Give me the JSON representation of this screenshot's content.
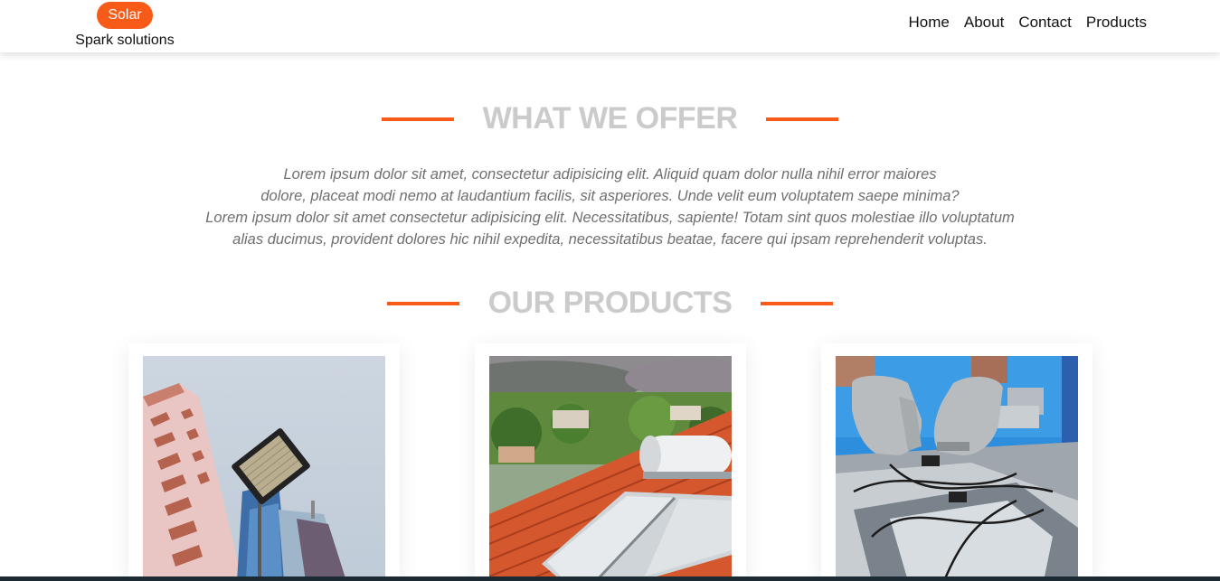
{
  "brand": {
    "badge": "Solar",
    "subtitle": "Spark solutions"
  },
  "nav": {
    "items": [
      "Home",
      "About",
      "Contact",
      "Products"
    ]
  },
  "offer": {
    "title": "WHAT WE OFFER",
    "lines": [
      "Lorem ipsum dolor sit amet, consectetur adipisicing elit. Aliquid quam dolor nulla nihil error maiores",
      "dolore, placeat modi nemo at laudantium facilis, sit asperiores. Unde velit eum voluptatem saepe minima?",
      "Lorem ipsum dolor sit amet consectetur adipisicing elit. Necessitatibus, sapiente! Totam sint quos molestiae illo voluptatum",
      "alias ducimus, provident dolores hic nihil expedita, necessitatibus beatae, facere qui ipsam reprehenderit voluptas."
    ]
  },
  "products": {
    "title": "OUR PRODUCTS"
  },
  "colors": {
    "accent": "#f85a18",
    "title_gray": "#cbcbcb",
    "body_text": "#6f6f6f",
    "footer": "#1c2a33"
  }
}
